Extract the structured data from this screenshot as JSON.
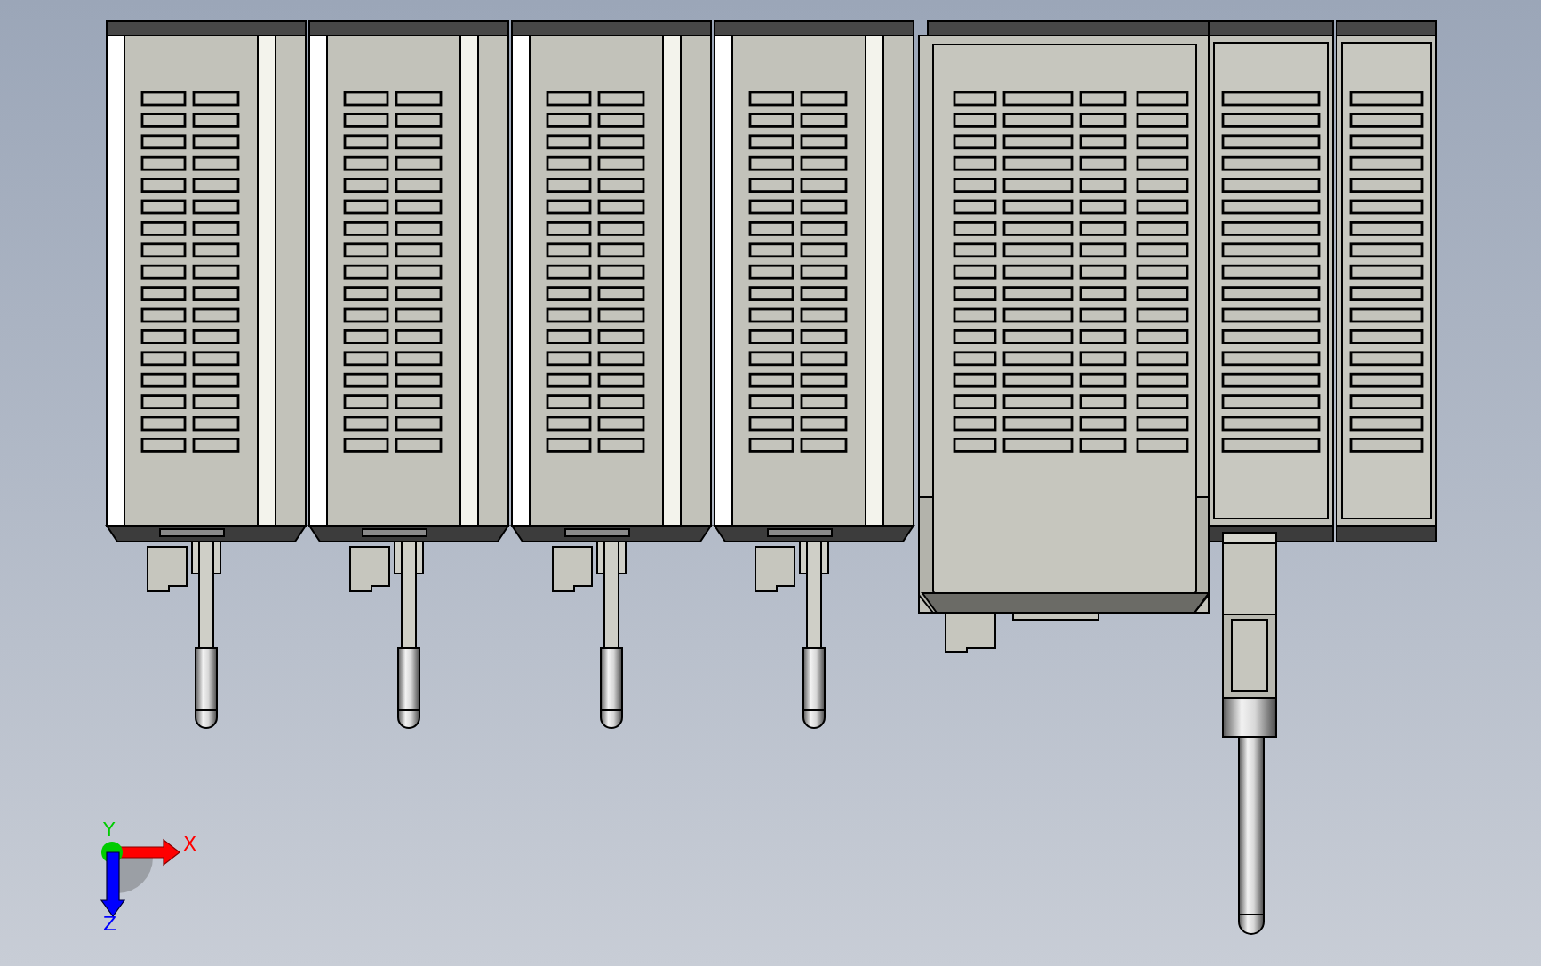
{
  "modules": [
    {
      "kind": "slice"
    },
    {
      "kind": "slice"
    },
    {
      "kind": "slice"
    },
    {
      "kind": "slice"
    },
    {
      "kind": "controller"
    },
    {
      "kind": "narrow"
    },
    {
      "kind": "narrow"
    }
  ],
  "axes": [
    {
      "label": "X",
      "color": "#ff0000"
    },
    {
      "label": "Y",
      "color": "#00cc00"
    },
    {
      "label": "Z",
      "color": "#0000ff"
    }
  ]
}
